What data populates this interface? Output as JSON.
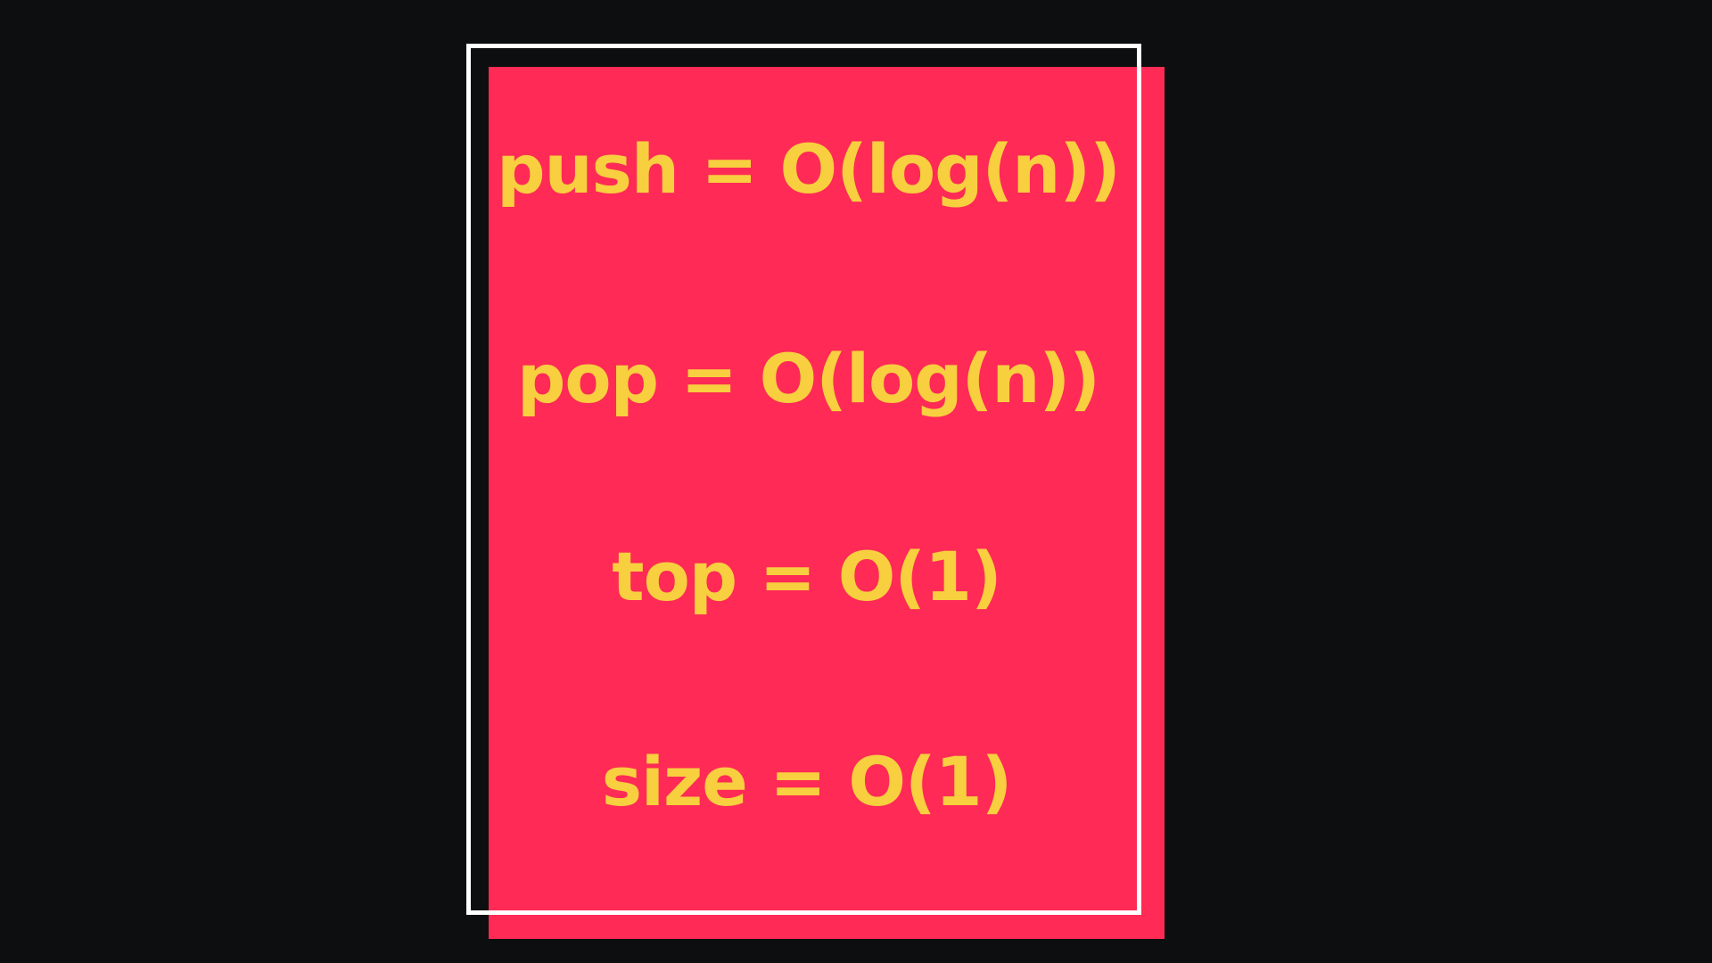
{
  "colors": {
    "background": "#0d0e10",
    "card": "#ff2a55",
    "frame": "#ffffff",
    "text": "#f7cf3f"
  },
  "complexities": [
    {
      "text": "push = O(log(n))"
    },
    {
      "text": "pop = O(log(n))"
    },
    {
      "text": "top = O(1)"
    },
    {
      "text": "size = O(1)"
    }
  ]
}
